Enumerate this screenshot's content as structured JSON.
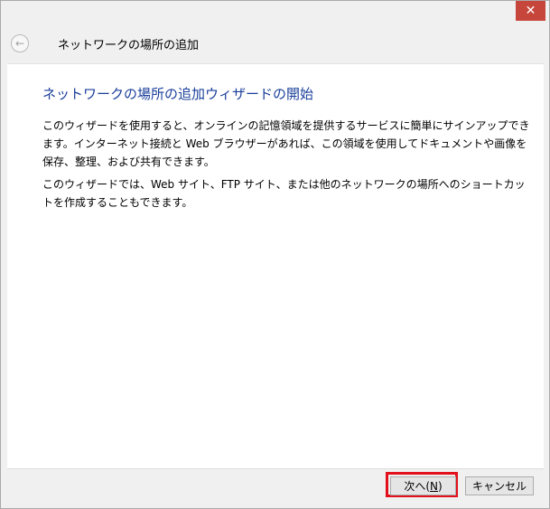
{
  "window": {
    "close_glyph": "✕",
    "back_glyph": "←",
    "title": "ネットワークの場所の追加"
  },
  "content": {
    "heading": "ネットワークの場所の追加ウィザードの開始",
    "paragraph1": "このウィザードを使用すると、オンラインの記憶領域を提供するサービスに簡単にサインアップできます。インターネット接続と Web ブラウザーがあれば、この領域を使用してドキュメントや画像を保存、整理、および共有できます。",
    "paragraph2": "このウィザードでは、Web サイト、FTP サイト、または他のネットワークの場所へのショートカットを作成することもできます。"
  },
  "footer": {
    "next_label_prefix": "次へ(",
    "next_label_key": "N",
    "next_label_suffix": ")",
    "cancel_label": "キャンセル",
    "highlight_color": "#e2101a"
  }
}
